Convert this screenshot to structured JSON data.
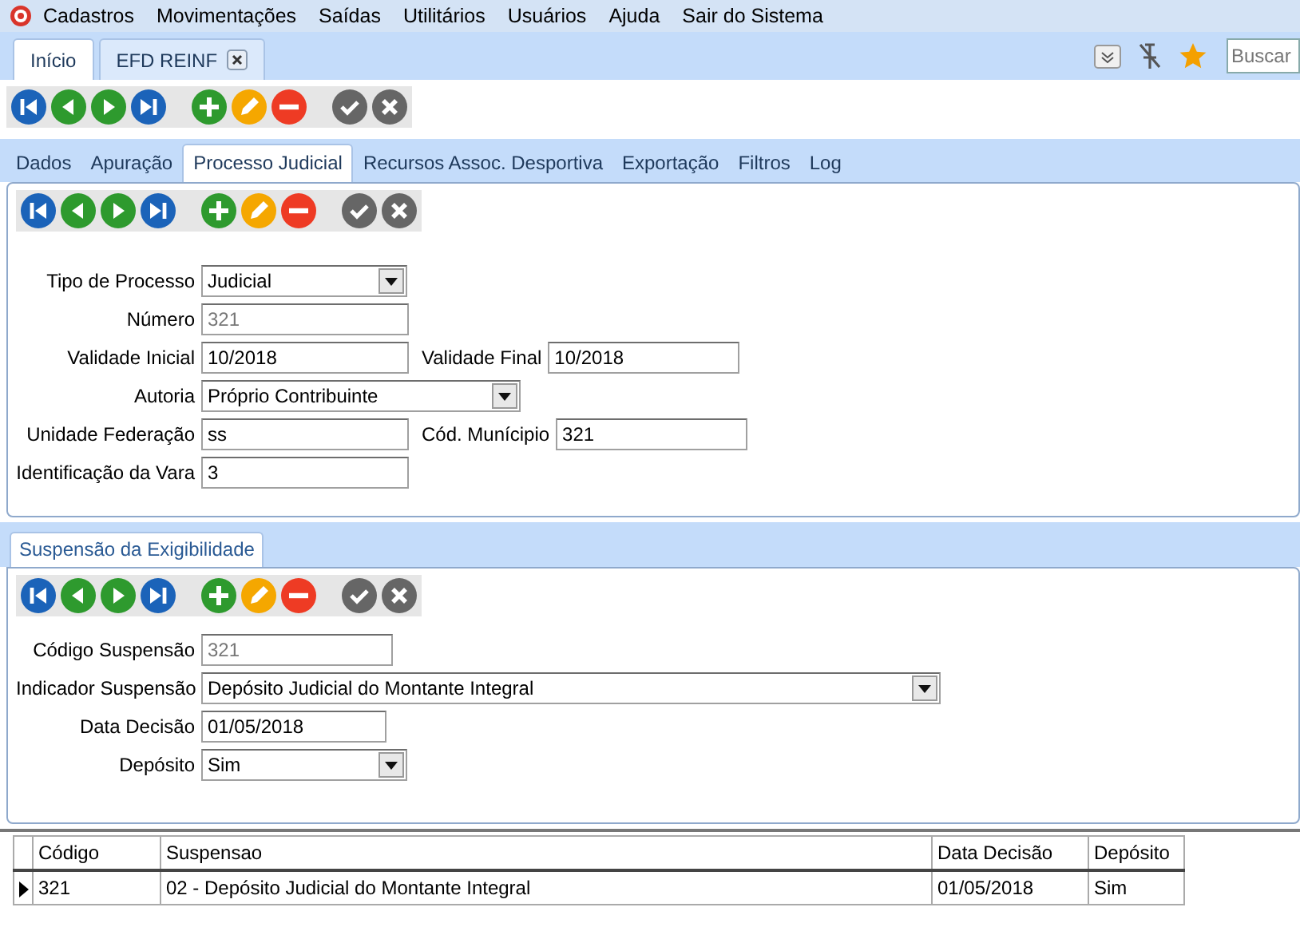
{
  "menu": [
    "Cadastros",
    "Movimentações",
    "Saídas",
    "Utilitários",
    "Usuários",
    "Ajuda",
    "Sair do Sistema"
  ],
  "doc_tabs": [
    {
      "label": "Início",
      "selected": true,
      "closable": false
    },
    {
      "label": "EFD REINF",
      "selected": false,
      "closable": true
    }
  ],
  "search": {
    "placeholder": "Buscar"
  },
  "toolbar": [
    {
      "kind": "first"
    },
    {
      "kind": "prev"
    },
    {
      "kind": "next"
    },
    {
      "kind": "last"
    },
    {
      "kind": "add"
    },
    {
      "kind": "edit"
    },
    {
      "kind": "delete"
    },
    {
      "kind": "confirm"
    },
    {
      "kind": "cancel"
    }
  ],
  "tabs": [
    {
      "label": "Dados",
      "selected": false
    },
    {
      "label": "Apuração",
      "selected": false
    },
    {
      "label": "Processo Judicial",
      "selected": true
    },
    {
      "label": "Recursos Assoc. Desportiva",
      "selected": false
    },
    {
      "label": "Exportação",
      "selected": false
    },
    {
      "label": "Filtros",
      "selected": false
    },
    {
      "label": "Log",
      "selected": false
    }
  ],
  "process_toolbar": [
    {
      "kind": "first"
    },
    {
      "kind": "prev"
    },
    {
      "kind": "next"
    },
    {
      "kind": "last"
    },
    {
      "kind": "add"
    },
    {
      "kind": "edit"
    },
    {
      "kind": "delete"
    },
    {
      "kind": "confirm"
    },
    {
      "kind": "cancel"
    }
  ],
  "process_form": [
    [
      {
        "label": "Tipo de Processo",
        "kind": "select",
        "value": "Judicial",
        "disabled": false
      }
    ],
    [
      {
        "label": "Número",
        "kind": "text",
        "value": "321",
        "disabled": true
      }
    ],
    [
      {
        "label": "Validade Inicial",
        "kind": "text",
        "value": "10/2018",
        "disabled": false
      },
      {
        "label": "Validade Final",
        "kind": "text",
        "value": "10/2018",
        "disabled": false
      }
    ],
    [
      {
        "label": "Autoria",
        "kind": "select",
        "value": "Próprio Contribuinte",
        "disabled": false
      }
    ],
    [
      {
        "label": "Unidade Federação",
        "kind": "text",
        "value": "ss",
        "disabled": false
      },
      {
        "label": "Cód. Munícipio",
        "kind": "text",
        "value": "321",
        "disabled": false
      }
    ],
    [
      {
        "label": "Identificação da Vara",
        "kind": "text",
        "value": "3",
        "disabled": false
      }
    ]
  ],
  "sub_tabs": [
    {
      "label": "Suspensão da Exigibilidade",
      "selected": true
    }
  ],
  "suspension_toolbar": [
    {
      "kind": "first"
    },
    {
      "kind": "prev"
    },
    {
      "kind": "next"
    },
    {
      "kind": "last"
    },
    {
      "kind": "add"
    },
    {
      "kind": "edit"
    },
    {
      "kind": "delete"
    },
    {
      "kind": "confirm"
    },
    {
      "kind": "cancel"
    }
  ],
  "suspension_form": [
    [
      {
        "label": "Código Suspensão",
        "kind": "text",
        "value": "321",
        "disabled": true
      }
    ],
    [
      {
        "label": "Indicador Suspensão",
        "kind": "select",
        "value": "Depósito Judicial do Montante Integral",
        "disabled": false
      }
    ],
    [
      {
        "label": "Data Decisão",
        "kind": "text",
        "value": "01/05/2018",
        "disabled": false
      }
    ],
    [
      {
        "label": "Depósito",
        "kind": "select",
        "value": "Sim",
        "disabled": false
      }
    ]
  ],
  "table": {
    "columns": [
      "Código",
      "Suspensao",
      "Data Decisão",
      "Depósito"
    ],
    "rows": [
      {
        "cells": [
          "321",
          "02 - Depósito Judicial do Montante Integral",
          "01/05/2018",
          "Sim"
        ],
        "selected": true
      }
    ]
  }
}
